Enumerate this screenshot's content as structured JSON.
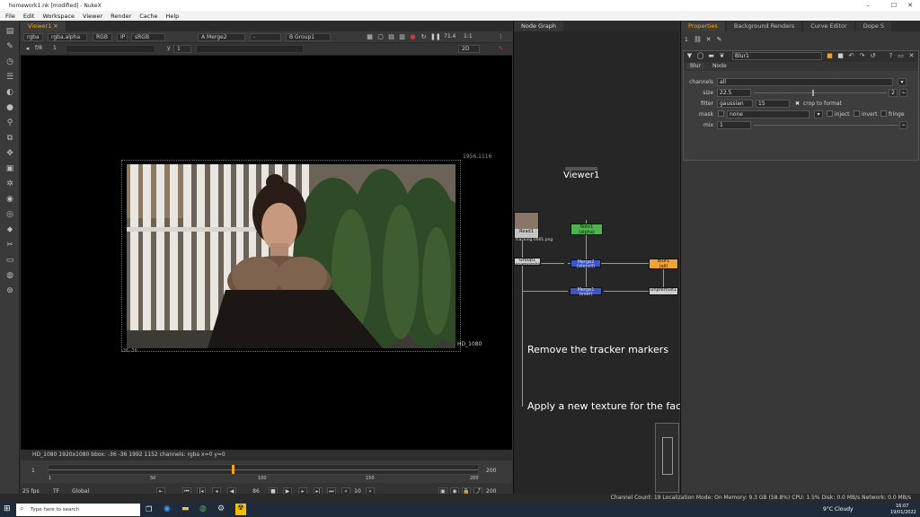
{
  "window": {
    "title": "homework1.nk [modified] - NukeX",
    "controls": [
      "–",
      "☐",
      "✕"
    ]
  },
  "menu": [
    "File",
    "Edit",
    "Workspace",
    "Viewer",
    "Render",
    "Cache",
    "Help"
  ],
  "viewer": {
    "tab": "Viewer1",
    "toolbar1": {
      "channels": "rgba",
      "alpha": "rgba.alpha",
      "display": "RGB",
      "ip": "IP",
      "lut": "sRGB",
      "a_input": "A  Merge2",
      "op": "-",
      "b_input": "B  Group1",
      "zoom": "71.4",
      "proxy": "1:1"
    },
    "toolbar2": {
      "fstop": "f/8",
      "frame_inc": "1",
      "y_label": "y",
      "y_value": "1",
      "view_mode": "2D"
    },
    "format_top_right": "1956,1116",
    "format_bottom_left": "-36,-36",
    "format_name": "HD_1080",
    "info_line": "HD_1080 1920x1080  bbox: -36 -36 1992 1152 channels: rgba        x=0 y=0",
    "timeline": {
      "start": "1",
      "end": "200",
      "ticks": [
        "1",
        "50",
        "100",
        "150",
        "200"
      ],
      "current_frame": "86",
      "playhead": 0.43
    },
    "playback": {
      "fps": "25 fps",
      "tf": "TF",
      "global": "Global",
      "frame": "86",
      "step": "10",
      "end_frame": "200"
    }
  },
  "nodegraph": {
    "tab": "Node Graph",
    "viewer_node": "Viewer1",
    "nodes": {
      "read": "Read1",
      "read_sub": "tracking.0001.png",
      "group": "Group1",
      "group_sub": "anamorphic",
      "roto": "Roto1",
      "roto_sub": "(alpha)",
      "merge_top": "Merge2 (stencil)",
      "merge_bottom": "Merge1 (over)",
      "blur": "Blur1",
      "blur_sub": "(all)",
      "premult": "Unpremult1"
    },
    "sticky1": "Remove the tracker markers",
    "sticky2": "Apply a new texture for the face"
  },
  "properties": {
    "tabs": [
      "Properties",
      "Background Renders",
      "Curve Editor",
      "Dope S"
    ],
    "max_panels": "1",
    "node_name": "Blur1",
    "subtabs": [
      "Blur",
      "Node"
    ],
    "channels_label": "channels",
    "channels_value": "all",
    "size_label": "size",
    "size_value": "22.5",
    "size_ticks": [
      "0",
      "10",
      "20",
      "30",
      "40",
      "50",
      "60",
      "70",
      "80",
      "90",
      "100"
    ],
    "size_count": "2",
    "filter_label": "filter",
    "filter_value": "gaussian",
    "quality_value": "15",
    "crop_label": "crop to format",
    "mask_label": "mask",
    "mask_value": "none",
    "inject_label": "inject",
    "invert_label": "invert",
    "fringe_label": "fringe",
    "mix_label": "mix",
    "mix_value": "1",
    "mix_ticks": [
      "0",
      "0.1",
      "0.2",
      "0.3",
      "0.4",
      "0.5",
      "0.6",
      "0.7",
      "0.8",
      "0.9",
      "1"
    ]
  },
  "status": "Channel Count: 19  Localization Mode: On  Memory: 9.3 GB (58.8%)  CPU: 1.5%  Disk: 0.0 MB/s  Network: 0.0 MB/s",
  "taskbar": {
    "search_placeholder": "Type here to search",
    "weather": "9°C  Cloudy",
    "time": "16:07",
    "date": "19/01/2022"
  }
}
